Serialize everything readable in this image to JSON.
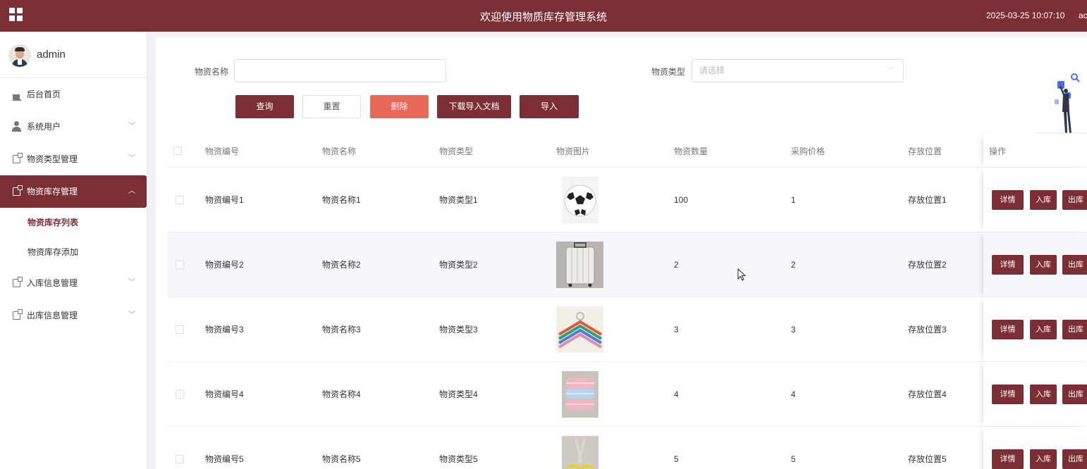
{
  "header": {
    "title": "欢迎使用物质库存管理系统",
    "datetime": "2025-03-25 10:07:10",
    "user_fragment": "ac",
    "menu_icon": "grid-menu-icon"
  },
  "sidebar": {
    "username": "admin",
    "items": [
      {
        "label": "后台首页",
        "icon": "home-icon"
      },
      {
        "label": "系统用户",
        "icon": "user-icon",
        "expandable": true
      },
      {
        "label": "物资类型管理",
        "icon": "document-icon",
        "expandable": true
      },
      {
        "label": "物资库存管理",
        "icon": "document-icon",
        "expandable": true,
        "active": true
      },
      {
        "label": "入库信息管理",
        "icon": "document-icon",
        "expandable": true
      },
      {
        "label": "出库信息管理",
        "icon": "document-icon",
        "expandable": true
      }
    ],
    "subitems": [
      {
        "label": "物资库存列表",
        "active": true
      },
      {
        "label": "物资库存添加"
      }
    ]
  },
  "search": {
    "name_label": "物资名称",
    "name_value": "",
    "type_label": "物资类型",
    "type_placeholder": "请选择"
  },
  "toolbar": {
    "query": "查询",
    "reset": "重置",
    "delete": "删除",
    "download_template": "下载导入文档",
    "import": "导入"
  },
  "table": {
    "headers": [
      "物资编号",
      "物资名称",
      "物资类型",
      "物资图片",
      "物资数量",
      "采购价格",
      "存放位置",
      "操作"
    ],
    "rows": [
      {
        "code": "物资编号1",
        "name": "物资名称1",
        "type": "物资类型1",
        "image": "soccer-ball",
        "qty": "100",
        "price": "1",
        "location": "存放位置1"
      },
      {
        "code": "物资编号2",
        "name": "物资名称2",
        "type": "物资类型2",
        "image": "suitcase",
        "qty": "2",
        "price": "2",
        "location": "存放位置2"
      },
      {
        "code": "物资编号3",
        "name": "物资名称3",
        "type": "物资类型3",
        "image": "hangers",
        "qty": "3",
        "price": "3",
        "location": "存放位置3"
      },
      {
        "code": "物资编号4",
        "name": "物资名称4",
        "type": "物资类型4",
        "image": "towels",
        "qty": "4",
        "price": "4",
        "location": "存放位置4"
      },
      {
        "code": "物资编号5",
        "name": "物资名称5",
        "type": "物资类型5",
        "image": "scissors",
        "qty": "5",
        "price": "5",
        "location": "存放位置5"
      }
    ],
    "actions": {
      "detail": "详情",
      "in": "入库",
      "out": "出库"
    }
  },
  "colors": {
    "brand": "#7b2f35",
    "danger": "#e8685a"
  }
}
